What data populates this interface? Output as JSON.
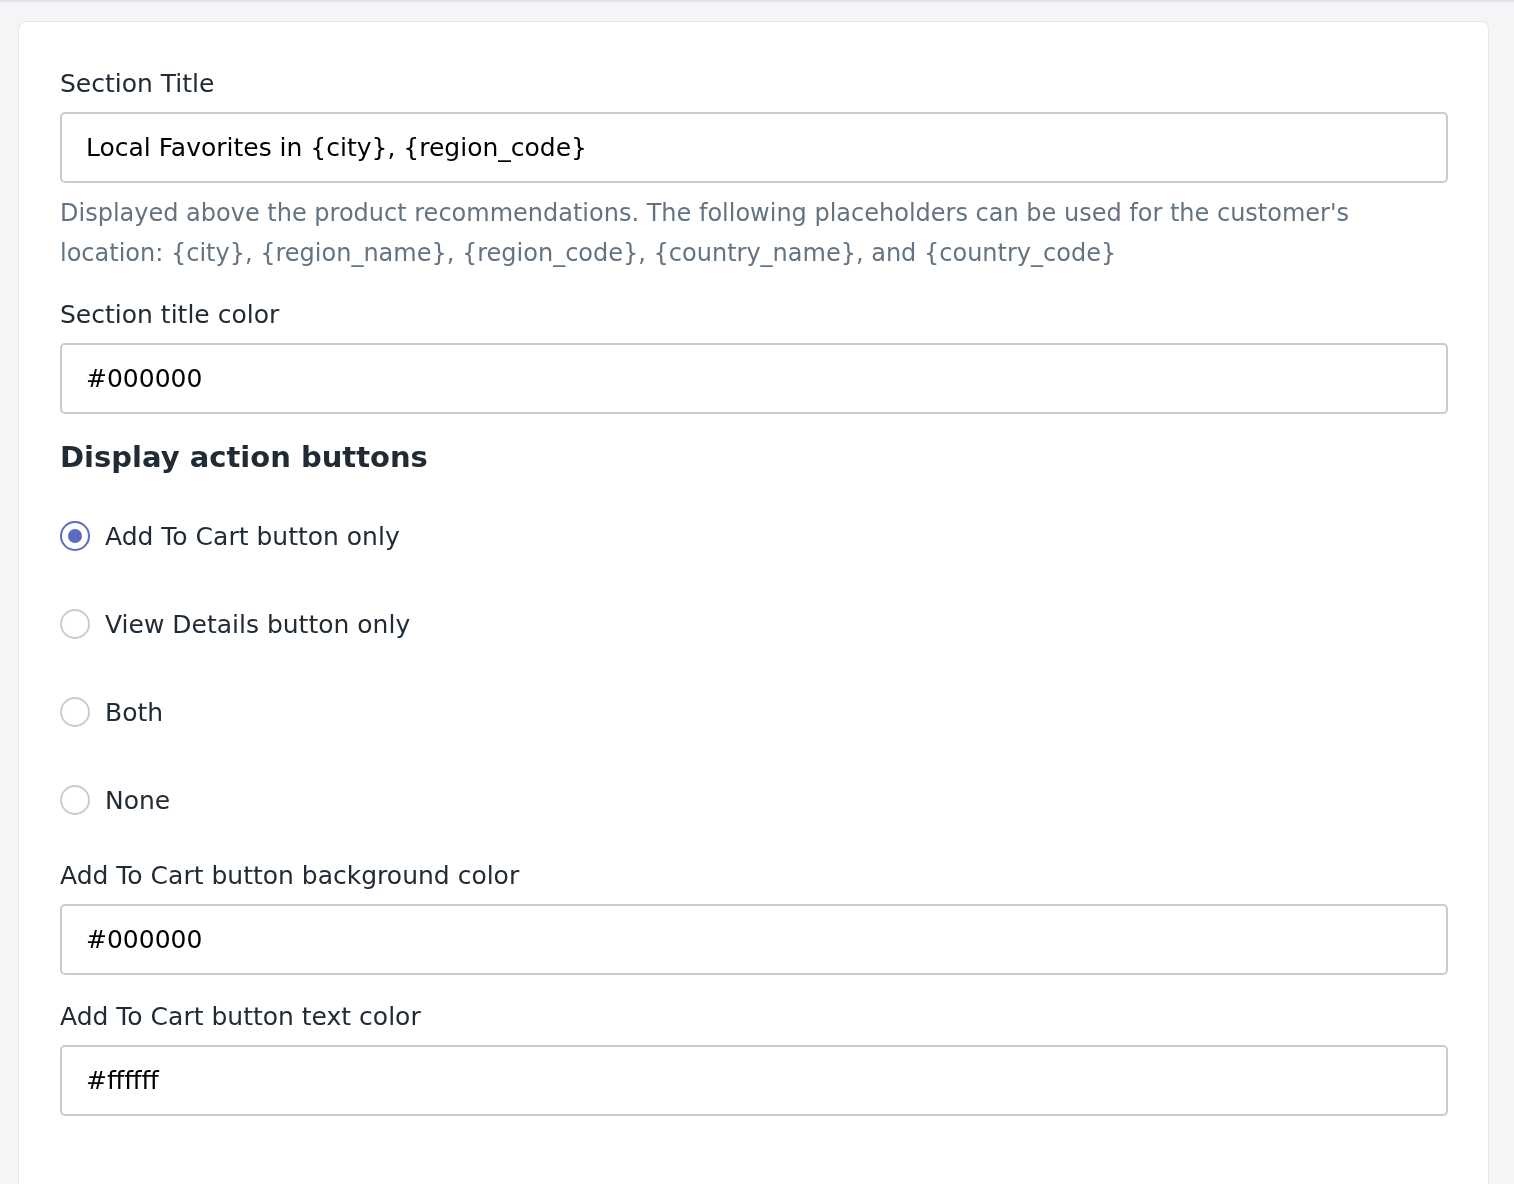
{
  "fields": [
    {
      "kind": "text",
      "label": "Section Title",
      "value": "Local Favorites in {city}, {region_code}",
      "help": "Displayed above the product recommendations. The following placeholders can be used for the customer's location: {city}, {region_name}, {region_code}, {country_name}, and {country_code}"
    },
    {
      "kind": "text",
      "label": "Section title color",
      "value": "#000000"
    },
    {
      "kind": "radio_group",
      "heading": "Display action buttons",
      "options": [
        {
          "label": "Add To Cart button only",
          "selected": true
        },
        {
          "label": "View Details button only",
          "selected": false
        },
        {
          "label": "Both",
          "selected": false
        },
        {
          "label": "None",
          "selected": false
        }
      ]
    },
    {
      "kind": "text",
      "label": "Add To Cart button background color",
      "value": "#000000"
    },
    {
      "kind": "text",
      "label": "Add To Cart button text color",
      "value": "#ffffff"
    }
  ]
}
